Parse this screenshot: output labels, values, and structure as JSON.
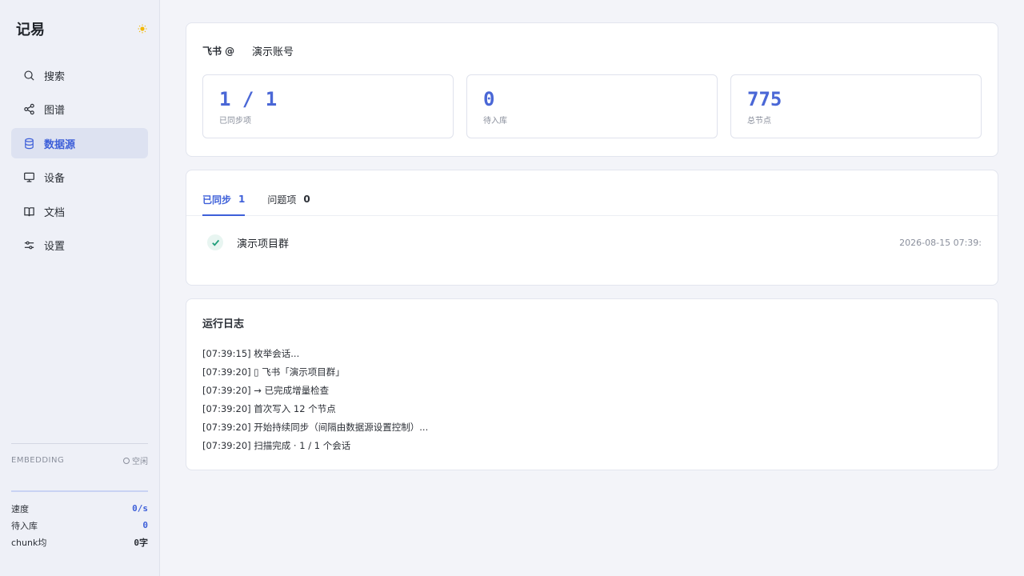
{
  "brand": {
    "title": "记易",
    "theme_icon": "sun-icon"
  },
  "nav": {
    "items": [
      {
        "label": "搜索",
        "icon": "search-icon"
      },
      {
        "label": "图谱",
        "icon": "share-graph-icon"
      },
      {
        "label": "数据源",
        "icon": "database-icon",
        "active": true
      },
      {
        "label": "设备",
        "icon": "monitor-icon"
      },
      {
        "label": "文档",
        "icon": "book-icon"
      },
      {
        "label": "设置",
        "icon": "sliders-icon"
      }
    ]
  },
  "embedding": {
    "label": "EMBEDDING",
    "status": "空闲"
  },
  "stats": {
    "speed_label": "速度",
    "speed_value": "0/s",
    "queue_label": "待入库",
    "queue_value": "0",
    "chunk_label": "chunk均",
    "chunk_value": "0字"
  },
  "account": {
    "source": "飞书 @",
    "name": "演示账号",
    "metrics": [
      {
        "value": "1 / 1",
        "label": "已同步项"
      },
      {
        "value": "0",
        "label": "待入库"
      },
      {
        "value": "775",
        "label": "总节点"
      }
    ]
  },
  "sync": {
    "tabs": [
      {
        "label": "已同步",
        "count": "1",
        "active": true
      },
      {
        "label": "问题项",
        "count": "0"
      }
    ],
    "items": [
      {
        "name": "演示项目群",
        "time": "2026-08-15 07:39:"
      }
    ]
  },
  "log": {
    "title": "运行日志",
    "lines": [
      "[07:39:15] 枚举会话...",
      "[07:39:20] ▯ 飞书「演示项目群」",
      "[07:39:20] → 已完成增量检查",
      "[07:39:20] 首次写入 12 个节点",
      "[07:39:20] 开始持续同步（间隔由数据源设置控制）...",
      "[07:39:20] 扫描完成 · 1 / 1 个会话"
    ]
  },
  "colors": {
    "accent": "#3d5fd9",
    "sun": "#f2b705",
    "check": "#1e9e7a"
  }
}
